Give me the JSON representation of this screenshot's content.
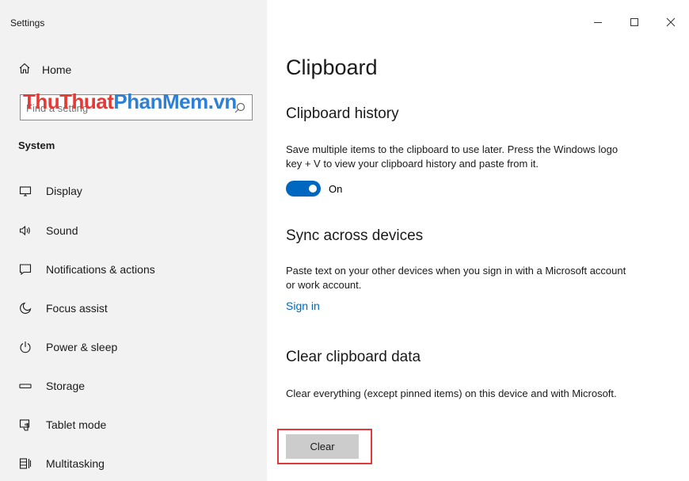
{
  "window": {
    "title": "Settings"
  },
  "sidebar": {
    "home_label": "Home",
    "search": {
      "placeholder": "Find a setting"
    },
    "watermark": {
      "part1": "ThuThuat",
      "part2": "PhanMem.vn"
    },
    "section_label": "System",
    "items": [
      {
        "label": "Display",
        "icon": "display-icon"
      },
      {
        "label": "Sound",
        "icon": "sound-icon"
      },
      {
        "label": "Notifications & actions",
        "icon": "notifications-icon"
      },
      {
        "label": "Focus assist",
        "icon": "focus-assist-icon"
      },
      {
        "label": "Power & sleep",
        "icon": "power-icon"
      },
      {
        "label": "Storage",
        "icon": "storage-icon"
      },
      {
        "label": "Tablet mode",
        "icon": "tablet-mode-icon"
      },
      {
        "label": "Multitasking",
        "icon": "multitasking-icon"
      }
    ]
  },
  "main": {
    "page_title": "Clipboard",
    "clipboard_history": {
      "heading": "Clipboard history",
      "description": "Save multiple items to the clipboard to use later. Press the Windows logo key + V to view your clipboard history and paste from it.",
      "toggle_state": "On",
      "toggle_on": true
    },
    "sync": {
      "heading": "Sync across devices",
      "description": "Paste text on your other devices when you sign in with a Microsoft account or work account.",
      "link": "Sign in"
    },
    "clear": {
      "heading": "Clear clipboard data",
      "description": "Clear everything (except pinned items) on this device and with Microsoft.",
      "button": "Clear"
    }
  },
  "colors": {
    "accent": "#0067c0",
    "highlight": "#e0393e",
    "sidebar_bg": "#f2f2f2"
  }
}
